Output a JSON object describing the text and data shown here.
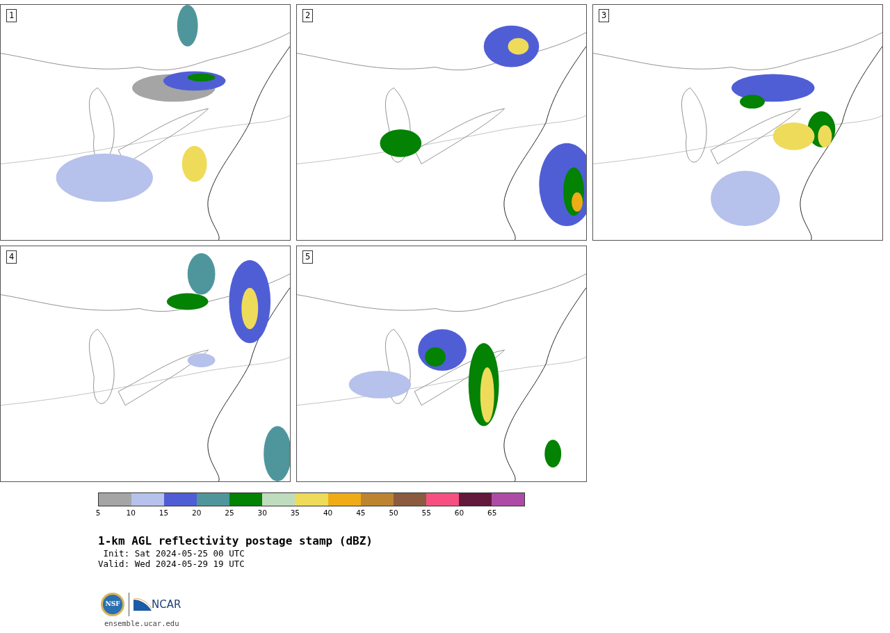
{
  "panels": [
    {
      "label": "1"
    },
    {
      "label": "2"
    },
    {
      "label": "3"
    },
    {
      "label": "4"
    },
    {
      "label": "5"
    }
  ],
  "colorbar": {
    "segments": [
      {
        "color": "#a5a5a5"
      },
      {
        "color": "#b6c1ec"
      },
      {
        "color": "#505ed6"
      },
      {
        "color": "#4f969c"
      },
      {
        "color": "#038203"
      },
      {
        "color": "#bfdcbe"
      },
      {
        "color": "#efdb5a"
      },
      {
        "color": "#efac17"
      },
      {
        "color": "#bc8431"
      },
      {
        "color": "#8b5a3f"
      },
      {
        "color": "#f55080"
      },
      {
        "color": "#62193b"
      },
      {
        "color": "#ae4ba7"
      }
    ],
    "ticks": [
      "5",
      "10",
      "15",
      "20",
      "25",
      "30",
      "35",
      "40",
      "45",
      "50",
      "55",
      "60",
      "65"
    ]
  },
  "title": "1-km AGL reflectivity postage stamp (dBZ)",
  "init": " Init: Sat 2024-05-25 00 UTC",
  "valid": "Valid: Wed 2024-05-29 19 UTC",
  "logo": {
    "seal": "NSF",
    "wordmark": "NCAR"
  },
  "url": "ensemble.ucar.edu"
}
